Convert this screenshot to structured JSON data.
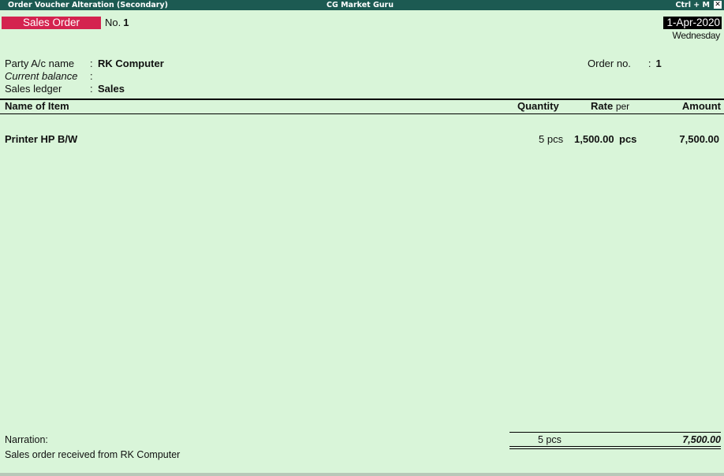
{
  "window": {
    "title": "Order Voucher  Alteration  (Secondary)",
    "company": "CG Market Guru",
    "shortcut": "Ctrl + M",
    "close_glyph": "✕"
  },
  "voucher": {
    "type": "Sales Order",
    "no_label": "No.",
    "number": "1",
    "date": "1-Apr-2020",
    "weekday": "Wednesday"
  },
  "party": {
    "name_label": "Party A/c name",
    "name": "RK Computer",
    "balance_label": "Current balance",
    "balance": "",
    "ledger_label": "Sales ledger",
    "ledger": "Sales",
    "order_no_label": "Order no.",
    "order_no": "1",
    "colon": ":"
  },
  "table": {
    "headers": {
      "item": "Name of Item",
      "quantity": "Quantity",
      "rate": "Rate",
      "per": "per",
      "amount": "Amount"
    },
    "rows": [
      {
        "item": "Printer HP B/W",
        "quantity": "5 pcs",
        "rate": "1,500.00",
        "per": "pcs",
        "amount": "7,500.00"
      }
    ]
  },
  "footer": {
    "narration_label": "Narration:",
    "narration": "Sales order received from RK Computer",
    "total_quantity": "5 pcs",
    "total_amount": "7,500.00"
  },
  "colors": {
    "background": "#d9f5d9",
    "titlebar": "#1c5a52",
    "voucher_type_badge": "#d4234f",
    "date_badge": "#000000"
  }
}
